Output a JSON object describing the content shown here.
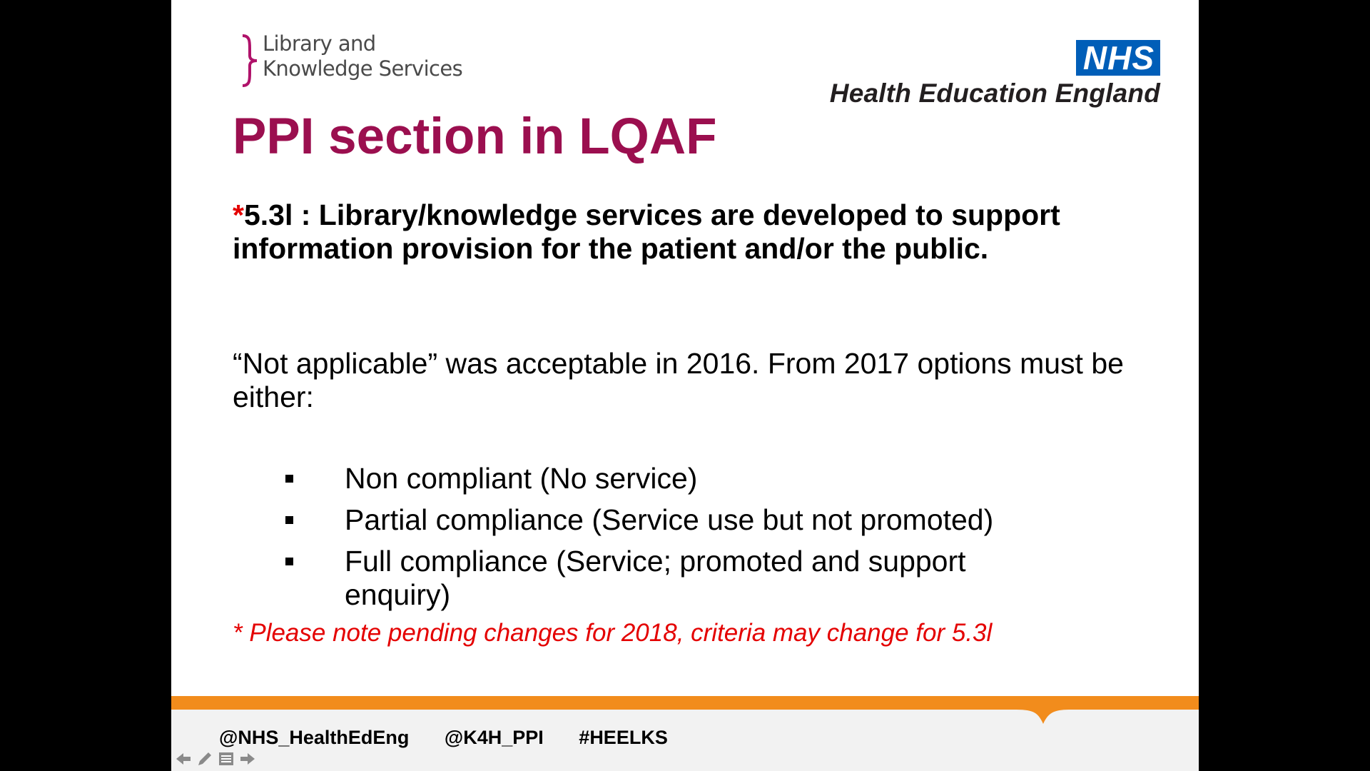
{
  "logos": {
    "lks_line1": "Library and",
    "lks_line2": "Knowledge Services",
    "nhs": "NHS",
    "hee": "Health Education England"
  },
  "slide": {
    "title": "PPI section in LQAF",
    "criterion_star": "*",
    "criterion_text": "5.3l : Library/knowledge services are developed to support information provision for the patient and/or the public.",
    "paragraph": "“Not applicable” was acceptable in 2016. From 2017  options must be either:",
    "options": [
      "Non compliant (No service)",
      "Partial compliance (Service use but not promoted)",
      "Full compliance (Service; promoted and support enquiry)"
    ],
    "note": "* Please note pending changes for 2018, criteria may change for 5.3l"
  },
  "footer": {
    "tags": [
      "@NHS_HealthEdEng",
      "@K4H_PPI",
      "#HEELKS"
    ]
  },
  "nav": {
    "prev": "previous-slide",
    "pen": "pen-tool",
    "menu": "slide-menu",
    "next": "next-slide"
  },
  "colors": {
    "title": "#9b0f4f",
    "accent_red": "#e40000",
    "nhs_blue": "#005eb8",
    "footer_orange": "#f28c1c",
    "lks_brace": "#b0126a"
  }
}
